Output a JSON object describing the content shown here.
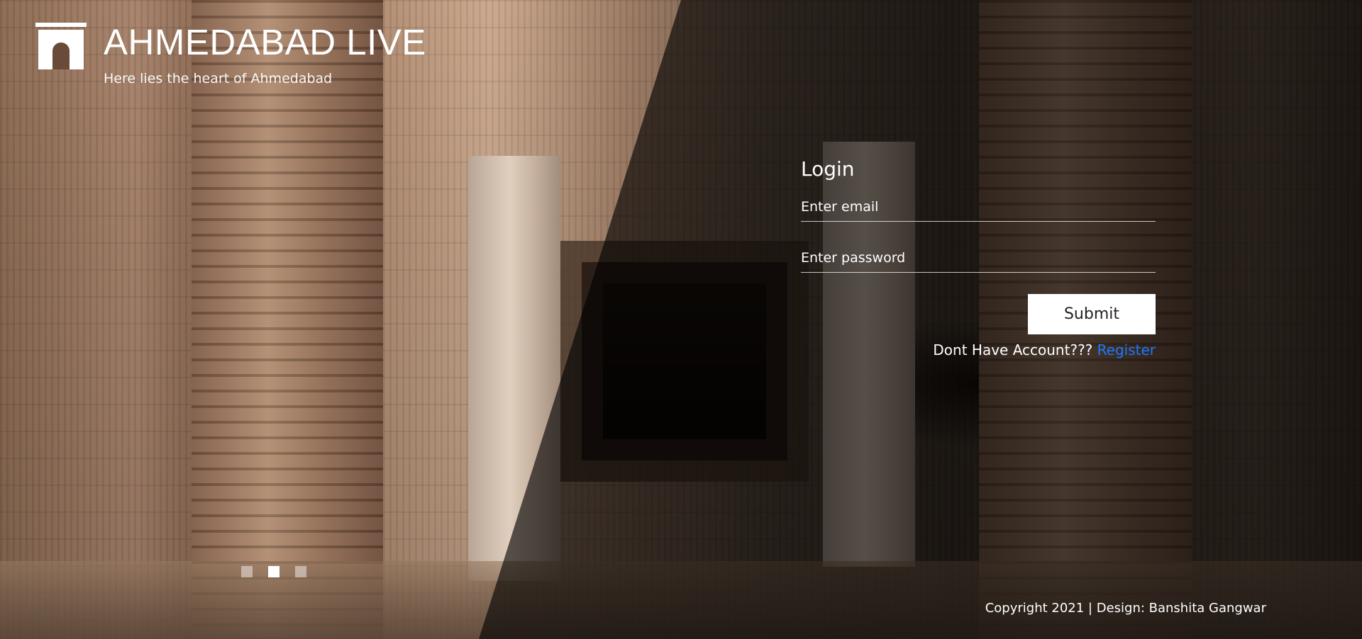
{
  "brand": {
    "title": "AHMEDABAD LIVE",
    "tagline": "Here lies the heart of Ahmedabad",
    "logo_icon": "stepwell-arch-icon"
  },
  "login": {
    "title": "Login",
    "email_placeholder": "Enter email",
    "email_value": "",
    "password_placeholder": "Enter password",
    "password_value": "",
    "submit_label": "Submit",
    "register_prompt": "Dont Have Account??? ",
    "register_link": "Register"
  },
  "carousel": {
    "slide_count": 3,
    "active_index": 1
  },
  "footer": {
    "copyright": "Copyright 2021 | Design: Banshita Gangwar"
  },
  "colors": {
    "link": "#1e78ff",
    "overlay": "rgba(0,0,0,0.62)",
    "button_bg": "#ffffff"
  }
}
